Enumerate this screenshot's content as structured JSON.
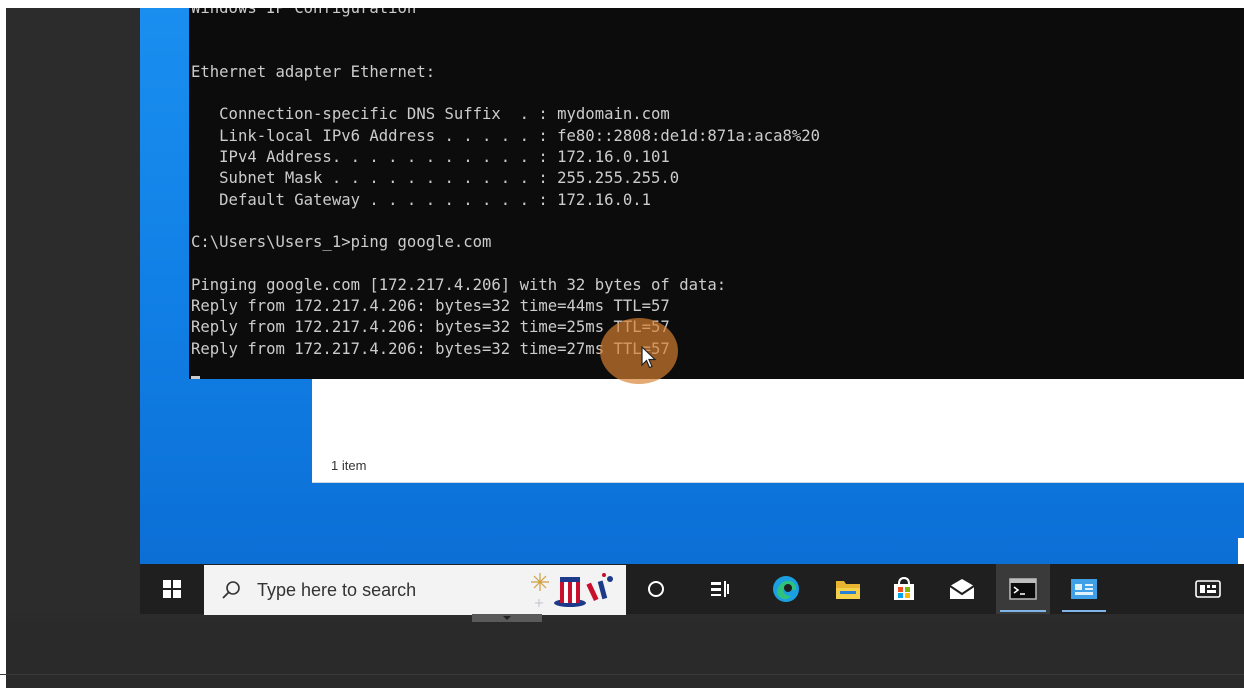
{
  "cmd": {
    "lines": [
      "Windows IP Configuration",
      "",
      "",
      "Ethernet adapter Ethernet:",
      "",
      "   Connection-specific DNS Suffix  . : mydomain.com",
      "   Link-local IPv6 Address . . . . . : fe80::2808:de1d:871a:aca8%20",
      "   IPv4 Address. . . . . . . . . . . : 172.16.0.101",
      "   Subnet Mask . . . . . . . . . . . : 255.255.255.0",
      "   Default Gateway . . . . . . . . . : 172.16.0.1",
      "",
      "C:\\Users\\Users_1>ping google.com",
      "",
      "Pinging google.com [172.217.4.206] with 32 bytes of data:",
      "Reply from 172.217.4.206: bytes=32 time=44ms TTL=57",
      "Reply from 172.217.4.206: bytes=32 time=25ms TTL=57",
      "Reply from 172.217.4.206: bytes=32 time=27ms TTL=57"
    ]
  },
  "explorer": {
    "status_text": "1 item"
  },
  "taskbar": {
    "search_placeholder": "Type here to search",
    "icons": [
      "windows-start-icon",
      "search-icon",
      "task-view-icon",
      "timeline-icon",
      "edge-icon",
      "file-explorer-icon",
      "store-icon",
      "mail-icon",
      "cmd-icon",
      "network-app-icon",
      "keyboard-icon"
    ]
  },
  "colors": {
    "desktop": "#1180e6",
    "terminal_bg": "#0c0c0c",
    "terminal_text": "#cccccc",
    "taskbar": "#1f1f1f",
    "click_indicator": "#d88032"
  }
}
